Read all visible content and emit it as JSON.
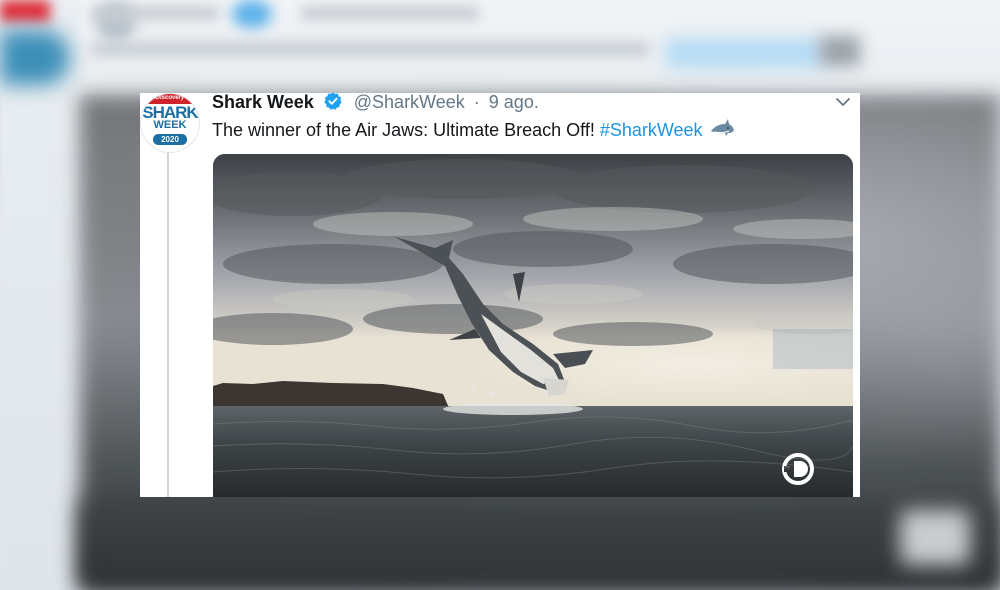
{
  "tweet": {
    "display_name": "Shark Week",
    "handle": "@SharkWeek",
    "separator": "·",
    "date": "9 ago.",
    "text": "The winner of the Air Jaws: Ultimate Breach Off! ",
    "hashtag": "#SharkWeek",
    "emoji": "shark-emoji"
  },
  "avatar": {
    "brand": "Discovery",
    "line1": "SHARK",
    "line2": "WEEK",
    "year": "2020"
  },
  "icons": {
    "verified": "verified-badge-icon",
    "menu": "chevron-down-icon",
    "watermark": "discovery-logo-icon"
  },
  "colors": {
    "link": "#1b95e0",
    "text": "#14171a",
    "secondary": "#657786",
    "brand_red": "#d0222b",
    "brand_blue": "#1d6fa3"
  }
}
